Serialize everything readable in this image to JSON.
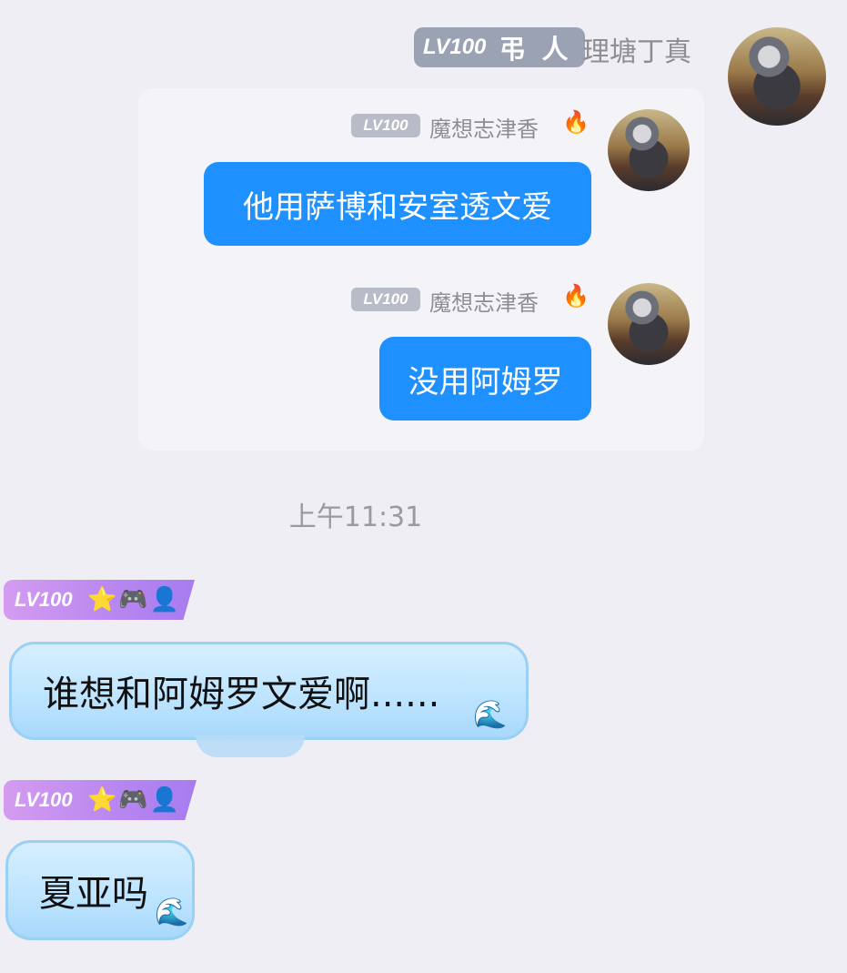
{
  "top_message": {
    "level": "LV100",
    "title": "弔 人",
    "sender": "理塘丁真",
    "avatar": "avatar-image"
  },
  "forwarded_card": {
    "messages": [
      {
        "level": "LV100",
        "sender": "魔想志津香",
        "icon": "fire-icon",
        "icon_char": "🔥",
        "text": "他用萨博和安室透文爱"
      },
      {
        "level": "LV100",
        "sender": "魔想志津香",
        "icon": "fire-icon",
        "icon_char": "🔥",
        "text": "没用阿姆罗"
      }
    ]
  },
  "timestamp": "上午11:31",
  "incoming": [
    {
      "level": "LV100",
      "badges": [
        "⭐",
        "🎮",
        "👤"
      ],
      "text": "谁想和阿姆罗文爱啊......"
    },
    {
      "level": "LV100",
      "badges": [
        "⭐",
        "🎮",
        "👤"
      ],
      "text": "夏亚吗"
    }
  ],
  "colors": {
    "background": "#eeeef4",
    "bubble_blue": "#1e90ff",
    "bubble_sky": "#bfe5ff",
    "badge_purple": "#b786f0"
  }
}
